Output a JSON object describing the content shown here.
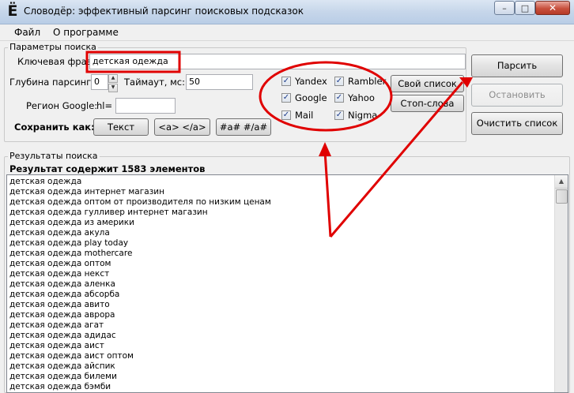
{
  "window": {
    "icon_glyph": "Ё",
    "title": "Словодёр: эффективный парсинг поисковых подсказок",
    "controls": {
      "minimize": "–",
      "maximize": "□",
      "close": "✕"
    }
  },
  "menu": [
    "Файл",
    "О программе"
  ],
  "params": {
    "legend": "Параметры поиска",
    "keyword_label": "Ключевая фраза:",
    "keyword_value": "детская одежда",
    "depth_label": "Глубина парсинга:",
    "depth_value": "0",
    "timeout_label": "Таймаут, мс:",
    "timeout_value": "50",
    "region_label": "Регион Google:",
    "hl_label": "hl=",
    "hl_value": "",
    "save_label": "Сохранить как:",
    "save_buttons": [
      "Текст",
      "<a> </a>",
      "#a# #/a#"
    ],
    "engines": [
      {
        "label": "Yandex",
        "checked": true
      },
      {
        "label": "Rambler",
        "checked": true
      },
      {
        "label": "Google",
        "checked": true
      },
      {
        "label": "Yahoo",
        "checked": true
      },
      {
        "label": "Mail",
        "checked": true
      },
      {
        "label": "Nigma",
        "checked": true
      }
    ],
    "own_list_button": "Свой список",
    "stopwords_button": "Стоп-слова"
  },
  "actions": {
    "parse": "Парсить",
    "stop": "Остановить",
    "clear": "Очистить список"
  },
  "results": {
    "legend": "Результаты поиска",
    "summary": "Результат содержит 1583 элементов",
    "items": [
      "детская одежда",
      "детская одежда интернет магазин",
      "детская одежда оптом от производителя по низким ценам",
      "детская одежда гулливер интернет магазин",
      "детская одежда из америки",
      "детская одежда акула",
      "детская одежда play today",
      "детская одежда mothercare",
      "детская одежда оптом",
      "детская одежда некст",
      "детская одежда аленка",
      "детская одежда абсорба",
      "детская одежда авито",
      "детская одежда аврора",
      "детская одежда агат",
      "детская одежда адидас",
      "детская одежда аист",
      "детская одежда аист оптом",
      "детская одежда айспик",
      "детская одежда билеми",
      "детская одежда бэмби"
    ]
  },
  "annotations": {
    "color": "#e00000"
  }
}
